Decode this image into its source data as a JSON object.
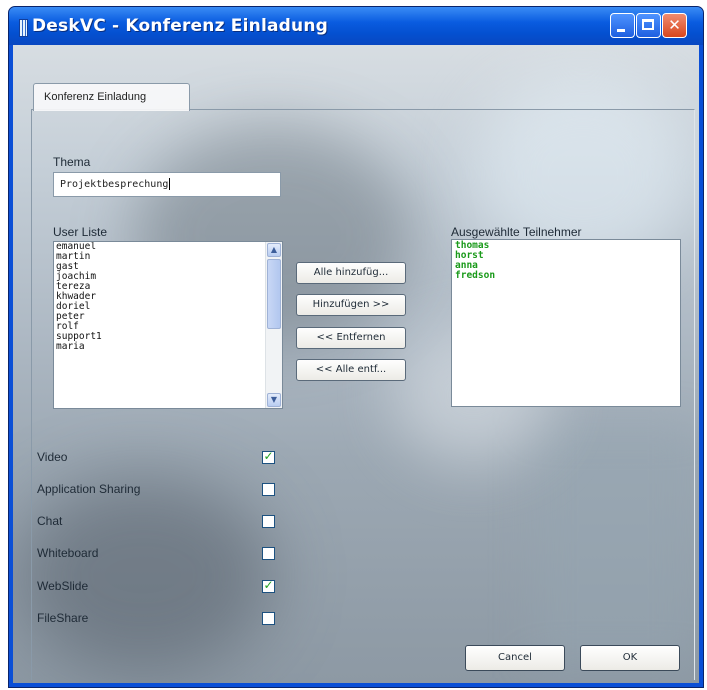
{
  "window": {
    "title": "DeskVC - Konferenz Einladung"
  },
  "tabs": [
    {
      "label": "Konferenz Einladung",
      "active": true
    }
  ],
  "thema": {
    "label": "Thema",
    "value": "Projektbesprechung"
  },
  "user_list": {
    "label": "User Liste",
    "items": [
      "emanuel",
      "martin",
      "gast",
      "joachim",
      "tereza",
      "khwader",
      "doriel",
      "peter",
      "rolf",
      "support1",
      "maria"
    ]
  },
  "selected": {
    "label": "Ausgewählte Teilnehmer",
    "items": [
      "thomas",
      "horst",
      "anna",
      "fredson"
    ],
    "text_color": "#1a9a1a"
  },
  "buttons": {
    "add_all": "Alle hinzufüg...",
    "add": "Hinzufügen >>",
    "remove": "<< Entfernen",
    "remove_all": "<< Alle entf...",
    "cancel": "Cancel",
    "ok": "OK"
  },
  "options": [
    {
      "label": "Video",
      "checked": true
    },
    {
      "label": "Application Sharing",
      "checked": false
    },
    {
      "label": "Chat",
      "checked": false
    },
    {
      "label": "Whiteboard",
      "checked": false
    },
    {
      "label": "WebSlide",
      "checked": true
    },
    {
      "label": "FileShare",
      "checked": false
    }
  ],
  "colors": {
    "titlebar": "#0a5ce0",
    "check": "#21a121"
  }
}
